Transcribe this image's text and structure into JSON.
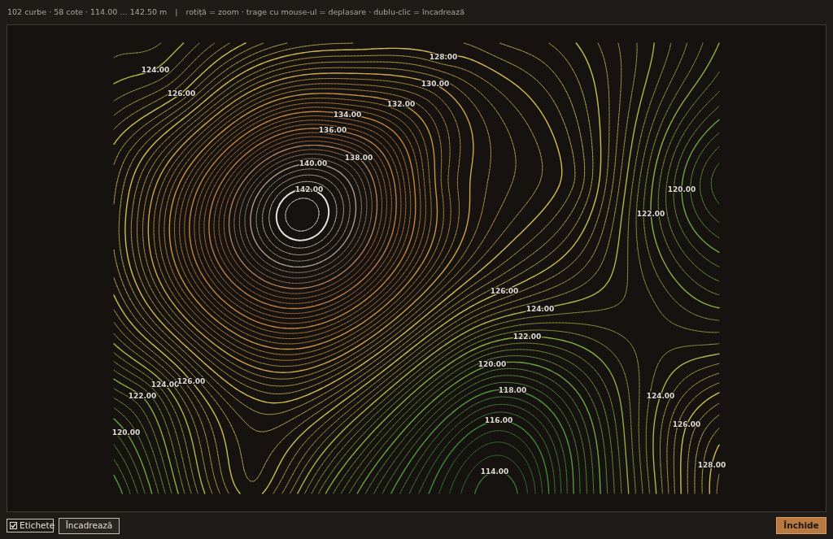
{
  "header": {
    "summary": "102 curbe · 58 cote · 114.00 … 142.50 m",
    "separator": "|",
    "hint": "rotiță = zoom · trage cu mouse-ul = deplasare · dublu-clic = încadrează"
  },
  "map": {
    "labels": [
      "128.00",
      "124.00",
      "130.00",
      "126.00",
      "132.00",
      "134.00",
      "136.00",
      "138.00",
      "140.00",
      "142.00",
      "120.00",
      "122.00",
      "126.00",
      "124.00",
      "122.00",
      "120.00",
      "124.00",
      "126.00",
      "118.00",
      "122.00",
      "124.00",
      "116.00",
      "126.00",
      "120.00",
      "128.00",
      "114.00"
    ]
  },
  "footer": {
    "labels_toggle": {
      "label": "Etichete",
      "checked": true
    },
    "fit_button": {
      "label": "Încadrează"
    },
    "close_button": {
      "label": "Închide"
    }
  }
}
